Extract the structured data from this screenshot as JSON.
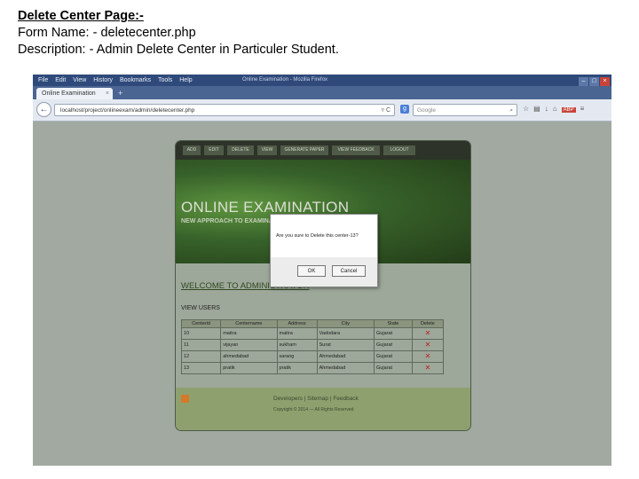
{
  "slide": {
    "title": "Delete Center Page:-",
    "form_name": "Form Name: - deletecenter.php",
    "description": "Description: - Admin Delete Center in Particuler Student."
  },
  "browser": {
    "menu": [
      "File",
      "Edit",
      "View",
      "History",
      "Bookmarks",
      "Tools",
      "Help"
    ],
    "window_title": "Online Examination - Mozilla Firefox",
    "tab_title": "Online Examination",
    "url": "localhost/project/onlineexam/admin/deletecenter.php",
    "search_placeholder": "Google"
  },
  "site": {
    "nav": [
      "ADD",
      "EDIT",
      "DELETE",
      "VIEW",
      "GENERATE PAPER",
      "VIEW FEEDBACK",
      "LOGOUT"
    ],
    "banner_title": "ONLINE EXAMINATION",
    "banner_subtitle": "NEW APPROACH TO EXAMINATION",
    "welcome": "WELCOME TO ADMINISTRATOR",
    "section_title": "VIEW USERS",
    "table": {
      "headers": [
        "Centerid",
        "Centername",
        "Address",
        "City",
        "State",
        "Delete"
      ],
      "rows": [
        [
          "10",
          "maitra",
          "maitra",
          "Vadodara",
          "Gujarat"
        ],
        [
          "11",
          "vijayan",
          "sukham",
          "Surat",
          "Gujarat"
        ],
        [
          "12",
          "ahmedabad",
          "sarang",
          "Ahmedabad",
          "Gujarat"
        ],
        [
          "13",
          "pratik",
          "pratik",
          "Ahmedabad",
          "Gujarat"
        ]
      ]
    },
    "footer_links": "Developers | Sitemap | Feedback",
    "footer_copy": "Copyright © 2014 — All Rights Reserved"
  },
  "dialog": {
    "message": "Are you sure to Delete this center-13?",
    "ok_label": "OK",
    "cancel_label": "Cancel"
  },
  "colors": {
    "delete_icon": "#b42222",
    "browser_chrome": "#2f4a7a"
  }
}
